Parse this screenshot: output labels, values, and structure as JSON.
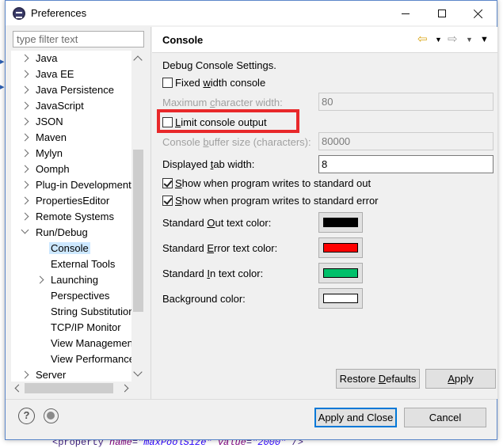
{
  "window": {
    "title": "Preferences"
  },
  "filter": {
    "placeholder": "type filter text"
  },
  "tree": {
    "items": [
      {
        "label": "Java"
      },
      {
        "label": "Java EE"
      },
      {
        "label": "Java Persistence"
      },
      {
        "label": "JavaScript"
      },
      {
        "label": "JSON"
      },
      {
        "label": "Maven"
      },
      {
        "label": "Mylyn"
      },
      {
        "label": "Oomph"
      },
      {
        "label": "Plug-in Development"
      },
      {
        "label": "PropertiesEditor"
      },
      {
        "label": "Remote Systems"
      },
      {
        "label": "Run/Debug"
      },
      {
        "label": "Console"
      },
      {
        "label": "External Tools"
      },
      {
        "label": "Launching"
      },
      {
        "label": "Perspectives"
      },
      {
        "label": "String Substitution"
      },
      {
        "label": "TCP/IP Monitor"
      },
      {
        "label": "View Management"
      },
      {
        "label": "View Performance"
      },
      {
        "label": "Server"
      }
    ],
    "selected": "Console"
  },
  "page": {
    "title": "Console",
    "description": "Debug Console Settings.",
    "fixed_width": {
      "pre": "Fixed ",
      "accel": "w",
      "post": "idth console",
      "checked": false
    },
    "max_char_width": {
      "pre": "Maximum ",
      "accel": "c",
      "post": "haracter width:",
      "value": "80"
    },
    "limit_output": {
      "pre": "",
      "accel": "L",
      "post": "imit console output",
      "checked": false
    },
    "buffer_size": {
      "pre": "Console ",
      "accel": "b",
      "post": "uffer size (characters):",
      "value": "80000"
    },
    "tab_width": {
      "pre": "Displayed ",
      "accel": "t",
      "post": "ab width:",
      "value": "8"
    },
    "show_out": {
      "pre": "",
      "accel": "S",
      "post": "how when program writes to standard out",
      "checked": true
    },
    "show_err": {
      "pre": "",
      "accel": "S",
      "post": "how when program writes to standard error",
      "checked": true
    },
    "std_out_color": {
      "pre": "Standard ",
      "accel": "O",
      "post": "ut text color:",
      "color": "#000000"
    },
    "std_err_color": {
      "pre": "Standard ",
      "accel": "E",
      "post": "rror text color:",
      "color": "#ff0000"
    },
    "std_in_color": {
      "pre": "Standard ",
      "accel": "I",
      "post": "n text color:",
      "color": "#00c06a"
    },
    "bg_color": {
      "label": "Background color:",
      "color": "#ffffff"
    },
    "restore_defaults": {
      "pre": "Restore ",
      "accel": "D",
      "post": "efaults"
    },
    "apply": {
      "pre": "",
      "accel": "A",
      "post": "pply"
    }
  },
  "footer": {
    "apply_close": "Apply and Close",
    "cancel": "Cancel"
  },
  "background": {
    "code": {
      "tag": "<property ",
      "attr1": "name",
      "val1": "\"maxPoolSize\"",
      "attr2": "value",
      "val2": "\"2000\"",
      "end": " />"
    }
  }
}
